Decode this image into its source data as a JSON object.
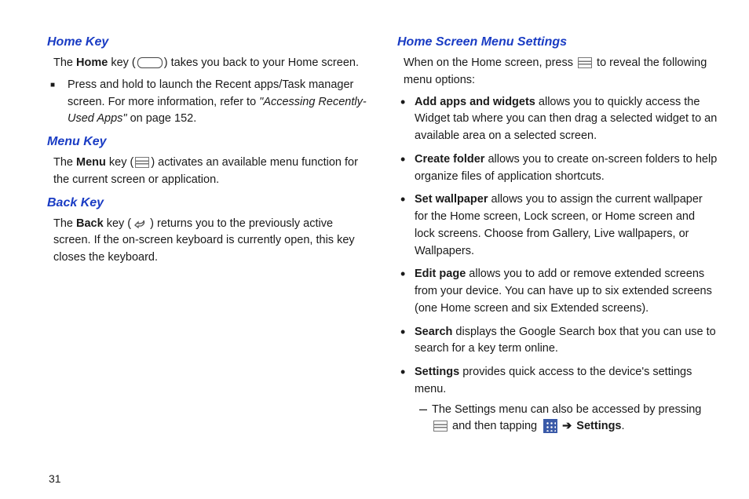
{
  "left": {
    "h1": "Home Key",
    "p1a": "The ",
    "p1b": "Home",
    "p1c": " key (",
    "p1d": ") takes you back to your Home screen.",
    "bullet1a": "Press and hold to launch the Recent apps/Task manager screen. For more information, refer to ",
    "bullet1b": "\"Accessing Recently-Used Apps\"",
    "bullet1c": "  on page 152.",
    "h2": "Menu Key",
    "p2a": "The ",
    "p2b": "Menu",
    "p2c": " key (",
    "p2d": ") activates an available menu function for the current screen or application.",
    "h3": "Back Key",
    "p3a": "The ",
    "p3b": "Back",
    "p3c": " key (",
    "p3d": ") returns you to the previously active screen. If the on-screen keyboard is currently open, this key closes the keyboard."
  },
  "right": {
    "h1": "Home Screen Menu Settings",
    "intro1": "When on the Home screen, press ",
    "intro2": " to reveal the following menu options:",
    "items": [
      {
        "b": "Add apps and widgets",
        "t": " allows you to quickly access the Widget tab where you can then drag a selected widget to an available area on a selected screen."
      },
      {
        "b": "Create folder",
        "t": " allows you to create on-screen folders to help organize files of application shortcuts."
      },
      {
        "b": "Set wallpaper",
        "t": " allows you to assign the current wallpaper for the Home screen, Lock screen, or Home screen and lock screens. Choose from Gallery, Live wallpapers, or Wallpapers."
      },
      {
        "b": "Edit page",
        "t": " allows you to add or remove extended screens from your device. You can have up to six extended screens (one Home screen and six Extended screens)."
      },
      {
        "b": "Search",
        "t": " displays the Google Search box that you can use to search for a key term online."
      },
      {
        "b": "Settings",
        "t": " provides quick access to the device's settings menu."
      }
    ],
    "sub1": "The Settings menu can also be accessed by pressing ",
    "sub2": " and then tapping ",
    "sub3arrow": "➔",
    "sub3b": "Settings",
    "sub3end": "."
  },
  "pageNumber": "31"
}
